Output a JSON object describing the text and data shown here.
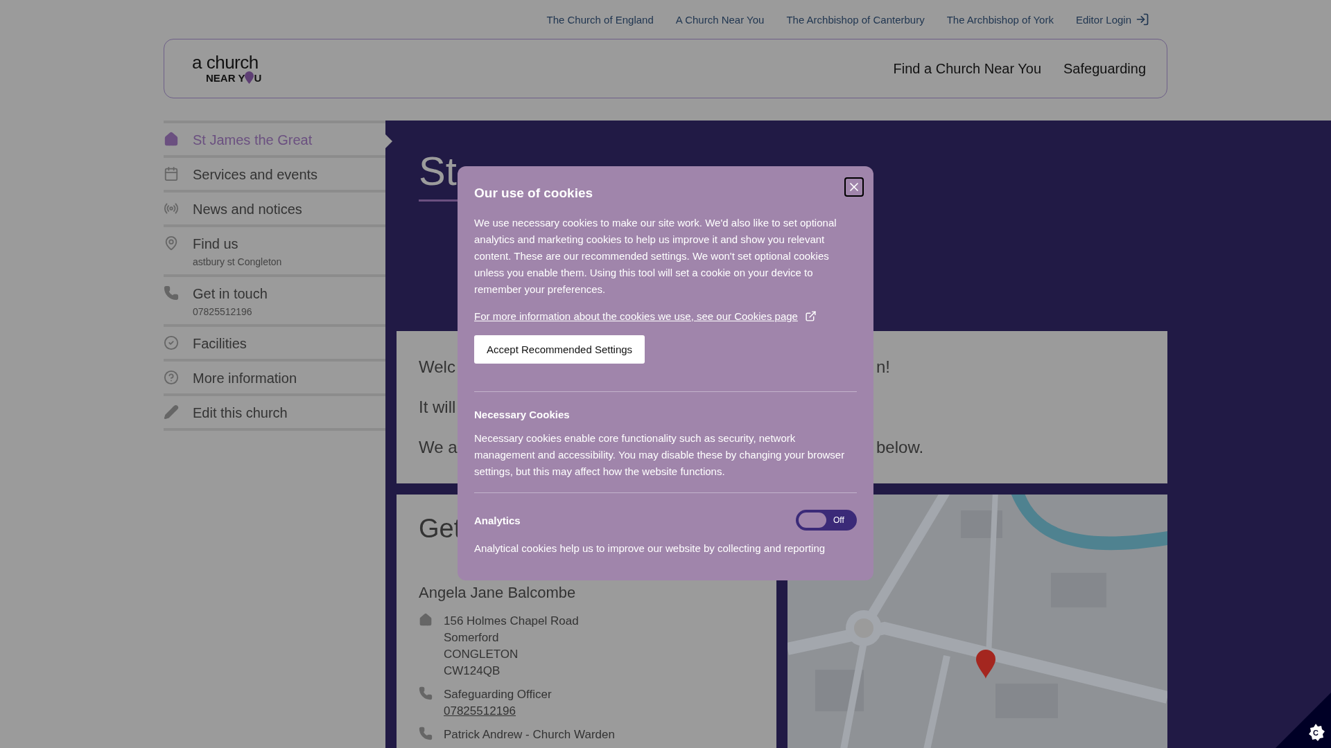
{
  "top_links": [
    {
      "label": "The Church of England",
      "kind": "link"
    },
    {
      "label": "A Church Near You",
      "kind": "link"
    },
    {
      "label": "The Archbishop of Canterbury",
      "kind": "link"
    },
    {
      "label": "The Archbishop of York",
      "kind": "link"
    },
    {
      "label": "Editor Login",
      "kind": "login"
    }
  ],
  "logo": {
    "top": "a church",
    "bottom_start": "NEAR Y",
    "bottom_end": "U"
  },
  "header_nav": [
    "Find a Church Near You",
    "Safeguarding"
  ],
  "sidebar": {
    "items": [
      {
        "label": "St James the Great",
        "selected": true
      },
      {
        "label": "Services and events",
        "selected": false
      },
      {
        "label": "News and notices",
        "selected": false
      },
      {
        "label": "Find us",
        "sub": "astbury st Congleton",
        "selected": false
      },
      {
        "label": "Get in touch",
        "sub": "07825512196",
        "selected": false
      },
      {
        "label": "Facilities",
        "selected": false
      },
      {
        "label": "More information",
        "selected": false
      },
      {
        "label": "Edit this church",
        "selected": false
      }
    ]
  },
  "page_title": "St",
  "welcome": {
    "lines": [
      {
        "left": "Welc",
        "right": "n!"
      },
      {
        "left": "It will"
      },
      {
        "left": "We a",
        "right": "below."
      }
    ]
  },
  "contact": {
    "title": "Get",
    "name": "Angela Jane Balcombe",
    "entries": [
      {
        "lines": [
          "156 Holmes Chapel Road",
          "Somerford",
          "CONGLETON",
          "CW124QB"
        ]
      },
      {
        "lines": [
          "Safeguarding Officer"
        ],
        "link": "07825512196"
      },
      {
        "lines": [
          "Patrick Andrew - Church Warden"
        ]
      }
    ]
  },
  "map": {
    "kind": "picture"
  },
  "cookie_dialog": {
    "title": "Our use of cookies",
    "intro": "We use necessary cookies to make our site work. We'd also like to set optional analytics and marketing cookies to help us improve it and show you relevant content. These are our recommended settings. We won't set optional cookies unless you enable them. Using this tool will set a cookie on your device to remember your preferences.",
    "link": "For more information about the cookies we use, see our Cookies page",
    "accept": "Accept Recommended Settings",
    "sections": [
      {
        "title": "Necessary Cookies",
        "text": "Necessary cookies enable core functionality such as security, network management and accessibility. You may disable these by changing your browser settings, but this may affect how the website functions."
      },
      {
        "title": "Analytics",
        "toggle": {
          "on": false,
          "label": "Off"
        },
        "text": "Analytical cookies help us to improve our website by collecting and reporting"
      }
    ]
  },
  "cookie_settings_button": {
    "label": "C"
  }
}
